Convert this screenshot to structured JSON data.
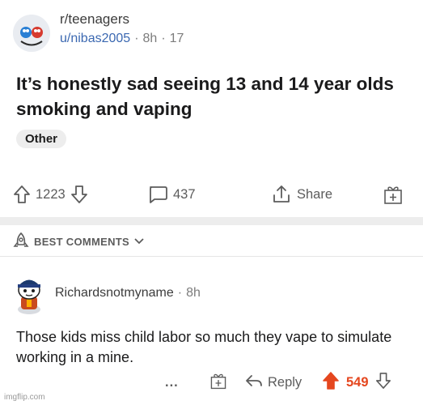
{
  "post": {
    "subreddit": "r/teenagers",
    "username": "u/nibas2005",
    "time": "8h",
    "awards_count": "17",
    "title": "It’s honestly sad seeing 13 and 14 year olds smoking and vaping",
    "flair": "Other"
  },
  "actions": {
    "score": "1223",
    "comments": "437",
    "share_label": "Share"
  },
  "sort": {
    "label": "BEST COMMENTS"
  },
  "comment": {
    "author": "Richardsnotmyname",
    "time": "8h",
    "text": "Those kids miss child labor so much they vape to simulate working in a mine.",
    "more_label": "...",
    "reply_label": "Reply",
    "score": "549"
  },
  "watermark": "imgflip.com",
  "colors": {
    "upvote": "#e5471f",
    "username": "#3b68b1",
    "divider": "#ededed"
  },
  "icons": [
    "subreddit-avatar",
    "upvote-icon",
    "downvote-icon",
    "comment-icon",
    "share-icon",
    "award-icon",
    "rocket-icon",
    "chevron-down-icon",
    "user-avatar",
    "reply-icon",
    "more-icon"
  ]
}
